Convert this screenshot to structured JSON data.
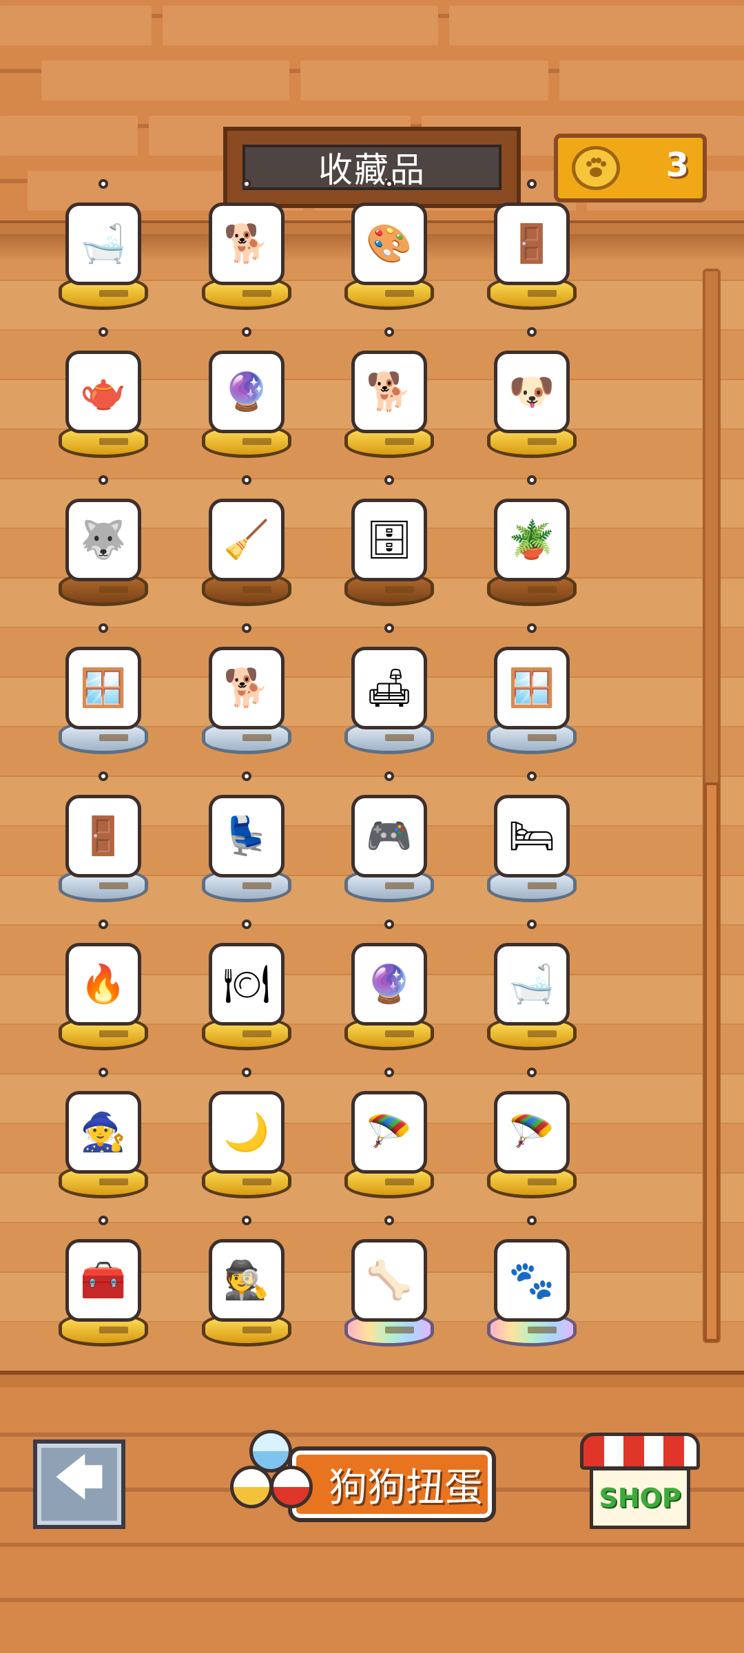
{
  "header": {
    "title": "收藏品",
    "coin_count": "3"
  },
  "collection": {
    "rows": [
      [
        {
          "name": "bathtub",
          "glyph": "🛁",
          "base": "gold"
        },
        {
          "name": "dog-pair",
          "glyph": "🐕",
          "base": "gold"
        },
        {
          "name": "easel",
          "glyph": "🎨",
          "base": "gold"
        },
        {
          "name": "doorway",
          "glyph": "🚪",
          "base": "gold"
        }
      ],
      [
        {
          "name": "tea-table",
          "glyph": "🫖",
          "base": "gold"
        },
        {
          "name": "dog-in-globe",
          "glyph": "🔮",
          "base": "gold"
        },
        {
          "name": "sleeping-dog",
          "glyph": "🐕",
          "base": "gold"
        },
        {
          "name": "dog-puppies",
          "glyph": "🐶",
          "base": "gold"
        }
      ],
      [
        {
          "name": "husky-sitting",
          "glyph": "🐺",
          "base": "bronze"
        },
        {
          "name": "mop",
          "glyph": "🧹",
          "base": "bronze"
        },
        {
          "name": "wardrobe",
          "glyph": "🗄",
          "base": "bronze"
        },
        {
          "name": "plant-chair",
          "glyph": "🪴",
          "base": "bronze"
        }
      ],
      [
        {
          "name": "window-cage",
          "glyph": "🪟",
          "base": "silver"
        },
        {
          "name": "dog-trio",
          "glyph": "🐕",
          "base": "silver"
        },
        {
          "name": "dog-sofa",
          "glyph": "🛋",
          "base": "silver"
        },
        {
          "name": "round-window",
          "glyph": "🪟",
          "base": "silver"
        }
      ],
      [
        {
          "name": "arched-door",
          "glyph": "🚪",
          "base": "silver"
        },
        {
          "name": "armchair",
          "glyph": "💺",
          "base": "silver"
        },
        {
          "name": "game-console",
          "glyph": "🎮",
          "base": "silver"
        },
        {
          "name": "dog-bed",
          "glyph": "🛏",
          "base": "silver"
        }
      ],
      [
        {
          "name": "fireplace",
          "glyph": "🔥",
          "base": "gold"
        },
        {
          "name": "dinner-table",
          "glyph": "🍽",
          "base": "gold"
        },
        {
          "name": "dog-water-globe",
          "glyph": "🔮",
          "base": "gold"
        },
        {
          "name": "dog-bath",
          "glyph": "🛁",
          "base": "gold"
        }
      ],
      [
        {
          "name": "wizard-dog",
          "glyph": "🧙",
          "base": "gold"
        },
        {
          "name": "moon-dog",
          "glyph": "🌙",
          "base": "gold"
        },
        {
          "name": "parachute-shiba",
          "glyph": "🪂",
          "base": "gold"
        },
        {
          "name": "parachute-husky",
          "glyph": "🪂",
          "base": "gold"
        }
      ],
      [
        {
          "name": "treasure-box",
          "glyph": "🧰",
          "base": "gold"
        },
        {
          "name": "detective-dog",
          "glyph": "🕵",
          "base": "gold"
        },
        {
          "name": "dog-bone",
          "glyph": "🦴",
          "base": "rainbow"
        },
        {
          "name": "dog-owner",
          "glyph": "🐾",
          "base": "rainbow"
        }
      ]
    ]
  },
  "buttons": {
    "back_arrow": "🡄",
    "gacha_label": "狗狗扭蛋",
    "shop_label": "SHOP"
  },
  "colors": {
    "wall": "#d6874a",
    "floor": "#d99455",
    "coin_gold": "#f0a817",
    "gacha_orange": "#e97420",
    "shop_green": "#3eaa3c"
  }
}
